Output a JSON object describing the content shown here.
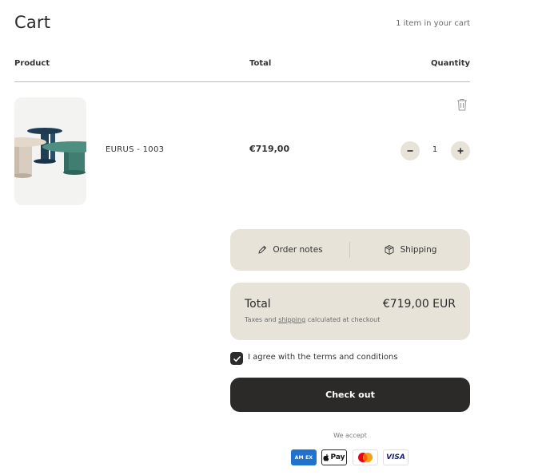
{
  "header": {
    "title": "Cart",
    "item_count_text": "1 item in your cart"
  },
  "table": {
    "columns": [
      "Product",
      "Total",
      "Quantity"
    ]
  },
  "items": [
    {
      "name": "EURUS - 1003",
      "price": "€719,00",
      "quantity": "1",
      "image_icon": "coffee-tables-product-image"
    }
  ],
  "actions": {
    "order_notes_label": "Order notes",
    "shipping_label": "Shipping"
  },
  "summary": {
    "total_label": "Total",
    "total_value": "€719,00 EUR",
    "tax_prefix": "Taxes and ",
    "tax_link": "shipping",
    "tax_suffix": " calculated at checkout"
  },
  "terms": {
    "label": "I agree with the terms and conditions",
    "checked": true
  },
  "checkout_label": "Check out",
  "payments": {
    "label": "We accept",
    "methods": [
      "American Express",
      "Apple Pay",
      "Mastercard",
      "Visa"
    ],
    "amex_text": "AM EX",
    "apple_text": "Pay",
    "visa_text": "VISA"
  },
  "colors": {
    "panel_bg": "#e7e3d8",
    "button_dark": "#2b2a29",
    "text": "#2b2b2b"
  }
}
